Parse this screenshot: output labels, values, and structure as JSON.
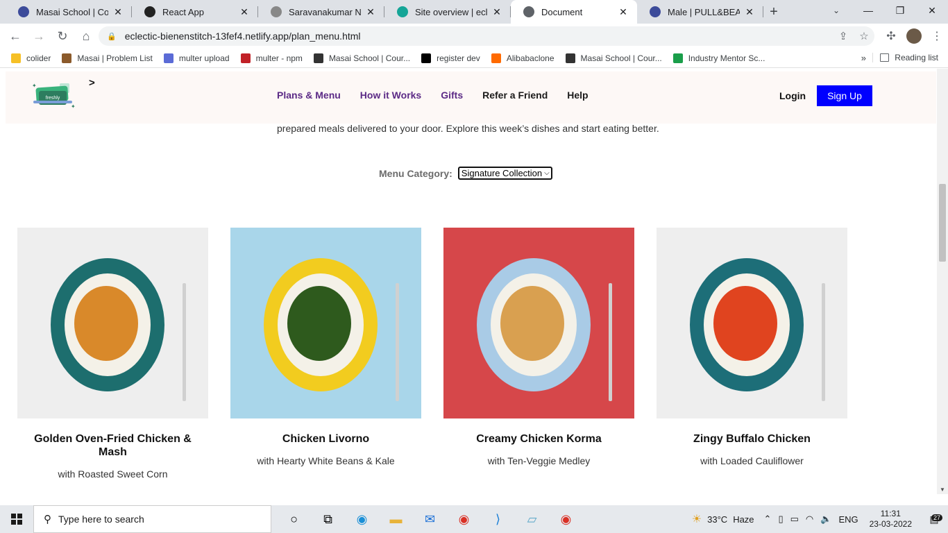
{
  "browser": {
    "tabs": [
      {
        "title": "Masai School | Course",
        "favicon_color": "#3c4b9a",
        "active": false
      },
      {
        "title": "React App",
        "favicon_color": "#222",
        "active": false
      },
      {
        "title": "Saravanakumar Nagar",
        "favicon_color": "#888",
        "active": false
      },
      {
        "title": "Site overview | eclectic",
        "favicon_color": "#15a597",
        "active": false
      },
      {
        "title": "Document",
        "favicon_color": "#5f6368",
        "active": true
      },
      {
        "title": "Male | PULL&BEAR Pu",
        "favicon_color": "#3c4b9a",
        "active": false
      }
    ],
    "new_tab_icon": "+",
    "url": "eclectic-bienenstitch-13fef4.netlify.app/plan_menu.html",
    "bookmarks": [
      {
        "label": "colider",
        "icon_color": "#f6c026"
      },
      {
        "label": "Masai | Problem List",
        "icon_color": "#8b5a2b"
      },
      {
        "label": "multer upload",
        "icon_color": "#5b6bd6"
      },
      {
        "label": "multer - npm",
        "icon_color": "#c12127"
      },
      {
        "label": "Masai School | Cour...",
        "icon_color": "#333"
      },
      {
        "label": "register dev",
        "icon_color": "#000"
      },
      {
        "label": "Alibabaclone",
        "icon_color": "#ff6a00"
      },
      {
        "label": "Masai School | Cour...",
        "icon_color": "#333"
      },
      {
        "label": "Industry Mentor Sc...",
        "icon_color": "#1a9e4a"
      }
    ],
    "bookmarks_more": "»",
    "reading_list": "Reading list"
  },
  "site": {
    "nav": {
      "plans_menu": "Plans & Menu",
      "how_it_works": "How it Works",
      "gifts": "Gifts",
      "refer": "Refer a Friend",
      "help": "Help"
    },
    "login": "Login",
    "signup": "Sign Up",
    "caret": ">",
    "logo_text": "freshly",
    "intro": "prepared meals delivered to your door. Explore this week’s dishes and start eating better.",
    "menu_category_label": "Menu Category:",
    "menu_category_value": "Signature Collection",
    "dishes": [
      {
        "name": "Golden Oven-Fried Chicken & Mash",
        "side": "with Roasted Sweet Corn",
        "bg": "#eeeeee",
        "plate": "#1d6e6e",
        "food": "#d9892a"
      },
      {
        "name": "Chicken Livorno",
        "side": "with Hearty White Beans & Kale",
        "bg": "#a9d6ea",
        "plate": "#f2cc1f",
        "food": "#2e5a1d"
      },
      {
        "name": "Creamy Chicken Korma",
        "side": "with Ten-Veggie Medley",
        "bg": "#d6474a",
        "plate": "#a9cbe6",
        "food": "#d9a050"
      },
      {
        "name": "Zingy Buffalo Chicken",
        "side": "with Loaded Cauliflower",
        "bg": "#eeeeee",
        "plate": "#1d6e78",
        "food": "#e0441f"
      }
    ]
  },
  "taskbar": {
    "search_placeholder": "Type here to search",
    "temperature": "33°C",
    "weather": "Haze",
    "language": "ENG",
    "time": "11:31",
    "date": "23-03-2022",
    "notifications": "27"
  }
}
